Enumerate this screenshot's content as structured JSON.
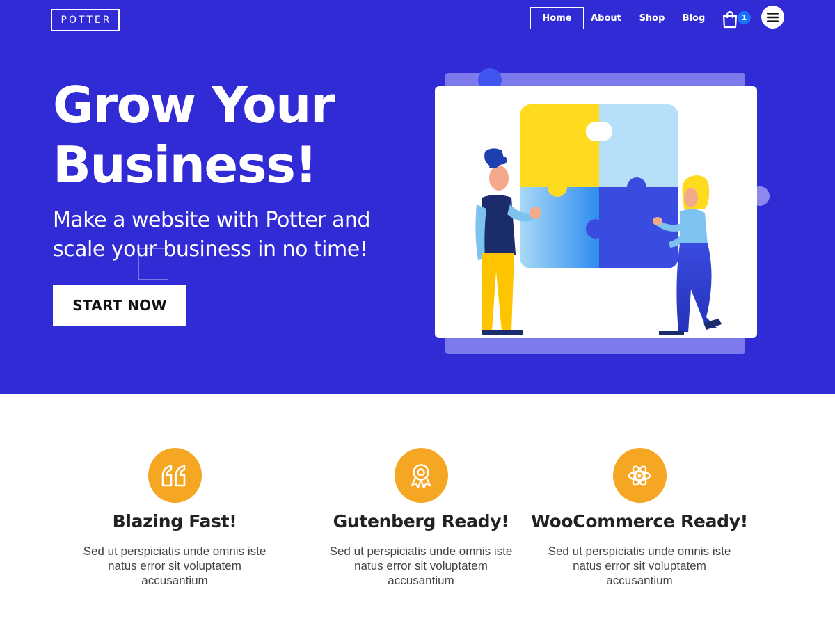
{
  "brand": {
    "logo_text": "POTTER"
  },
  "nav": {
    "items": [
      {
        "label": "Home",
        "active": true
      },
      {
        "label": "About"
      },
      {
        "label": "Shop"
      },
      {
        "label": "Blog"
      }
    ],
    "cart_count": "1",
    "cart_icon": "shopping-bag-icon",
    "menu_icon": "hamburger-icon"
  },
  "hero": {
    "title_line1": "Grow Your",
    "title_line2": "Business!",
    "subtitle_line1": "Make a website with Potter and",
    "subtitle_line2": "scale your business in no time!",
    "cta_label": "START NOW"
  },
  "features": [
    {
      "icon": "quote-icon",
      "title": "Blazing Fast!",
      "text_line1": "Sed ut perspiciatis unde omnis iste",
      "text_line2": "natus error sit voluptatem",
      "text_line3": "accusantium"
    },
    {
      "icon": "award-icon",
      "title": "Gutenberg Ready!",
      "text_line1": "Sed ut perspiciatis unde omnis iste",
      "text_line2": "natus error sit voluptatem",
      "text_line3": "accusantium"
    },
    {
      "icon": "atom-icon",
      "title": "WooCommerce Ready!",
      "text_line1": "Sed ut perspiciatis unde omnis iste",
      "text_line2": "natus error sit voluptatem",
      "text_line3": "accusantium"
    }
  ],
  "colors": {
    "hero_bg": "#312BD6",
    "accent_orange": "#F5A623",
    "badge_blue": "#1A73FF",
    "puzzle_yellow": "#FFDB1F",
    "puzzle_light_blue": "#B6E0FA",
    "puzzle_blue": "#3A4BE0"
  }
}
